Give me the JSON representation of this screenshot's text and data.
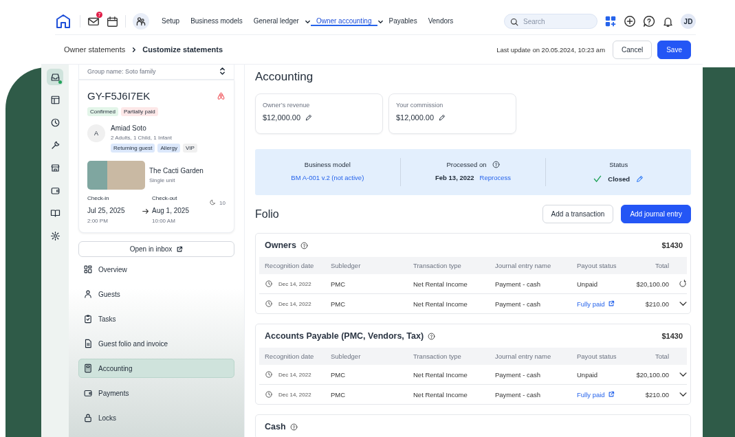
{
  "topnav": {
    "mail_badge": "7",
    "items": [
      {
        "label": "Setup",
        "dropdown": false,
        "selected": false
      },
      {
        "label": "Business models",
        "dropdown": false,
        "selected": false
      },
      {
        "label": "General ledger",
        "dropdown": true,
        "selected": false
      },
      {
        "label": "Owner accounting",
        "dropdown": true,
        "selected": true
      },
      {
        "label": "Payables",
        "dropdown": false,
        "selected": false
      },
      {
        "label": "Vendors",
        "dropdown": false,
        "selected": false
      }
    ],
    "search": {
      "placeholder": "Search"
    },
    "avatar": "JD"
  },
  "breadcrumb": [
    "Owner statements",
    "Customize statements"
  ],
  "last_update": "Last update on 20.05.2024, 10:23 am",
  "actions": {
    "cancel": "Cancel",
    "save": "Save"
  },
  "rail": [
    {
      "selected": true
    },
    {
      "selected": false
    },
    {
      "selected": false
    },
    {
      "selected": false
    },
    {
      "selected": false
    },
    {
      "selected": false
    },
    {
      "selected": false
    },
    {
      "selected": false
    }
  ],
  "reservation": {
    "group": "Group name: Soto family",
    "code": "GY-F5J6I7EK",
    "statuses": [
      {
        "label": "Confirmed",
        "color": "#e3f5e9"
      },
      {
        "label": "Partially paid",
        "color": "#fde8e8"
      }
    ],
    "guest": {
      "initial": "A",
      "name": "Amiad Soto",
      "party": "2 Adults, 1 Child, 1 Infant",
      "tags": [
        {
          "label": "Returning guest",
          "color": "#dce8fb"
        },
        {
          "label": "Allergy",
          "color": "#dce8fb"
        },
        {
          "label": "VIP",
          "color": "#f0f0f0"
        }
      ]
    },
    "property": {
      "name": "The Cacti Garden",
      "type": "Single unit"
    },
    "checkin": {
      "label": "Check-in",
      "date": "Jul 25, 2025",
      "time": "2:00 PM"
    },
    "checkout": {
      "label": "Check-out",
      "date": "Aug 1, 2025",
      "time": "10:00 AM"
    },
    "nights": "10",
    "open_inbox": "Open in inbox"
  },
  "sidebar": {
    "items": [
      {
        "label": "Overview",
        "selected": false
      },
      {
        "label": "Guests",
        "selected": false
      },
      {
        "label": "Tasks",
        "selected": false
      },
      {
        "label": "Guest folio and invoice",
        "selected": false
      },
      {
        "label": "Accounting",
        "selected": true
      },
      {
        "label": "Payments",
        "selected": false
      },
      {
        "label": "Locks",
        "selected": false
      }
    ]
  },
  "page_title": "Accounting",
  "stats": [
    {
      "label": "Owner’s revenue",
      "value": "$12,000.00"
    },
    {
      "label": "Your commission",
      "value": "$12,000.00"
    }
  ],
  "summary": {
    "business_model": {
      "label": "Business model",
      "value": "BM A-001 v.2 (not active)"
    },
    "processed": {
      "label": "Processed on",
      "date": "Feb 13, 2022",
      "action": "Reprocess"
    },
    "status": {
      "label": "Status",
      "value": "Closed"
    }
  },
  "folio": {
    "title": "Folio",
    "add_transaction": "Add a transaction",
    "add_journal": "Add journal entry",
    "sections": [
      {
        "title": "Owners",
        "total": "$1430",
        "columns": [
          "Recognition date",
          "Subledger",
          "Transaction type",
          "Journal entry name",
          "Payout status",
          "Total"
        ],
        "rows": [
          {
            "kind": "refresh",
            "date": "Dec 14, 2022",
            "subledger": "PMC",
            "type": "Net Rental Income",
            "journal": "Payment - cash",
            "payout": "Unpaid",
            "payout_link": false,
            "total": "$20,100.00"
          },
          {
            "kind": "expand",
            "date": "Dec 14, 2022",
            "subledger": "PMC",
            "type": "Net Rental Income",
            "journal": "Payment - cash",
            "payout": "Fully paid",
            "payout_link": true,
            "total": "$210.00"
          }
        ]
      },
      {
        "title": "Accounts Payable (PMC, Vendors, Tax)",
        "total": "$1430",
        "columns": [
          "Recognition date",
          "Subledger",
          "Transaction type",
          "Journal entry name",
          "Payout status",
          "Total"
        ],
        "rows": [
          {
            "kind": "expand",
            "date": "Dec 14, 2022",
            "subledger": "PMC",
            "type": "Net Rental Income",
            "journal": "Payment - cash",
            "payout": "Unpaid",
            "payout_link": false,
            "total": "$20,100.00"
          },
          {
            "kind": "expand",
            "date": "Dec 14, 2022",
            "subledger": "PMC",
            "type": "Net Rental Income",
            "journal": "Payment - cash",
            "payout": "Fully paid",
            "payout_link": true,
            "total": "$210.00"
          }
        ]
      },
      {
        "title": "Cash"
      }
    ]
  }
}
